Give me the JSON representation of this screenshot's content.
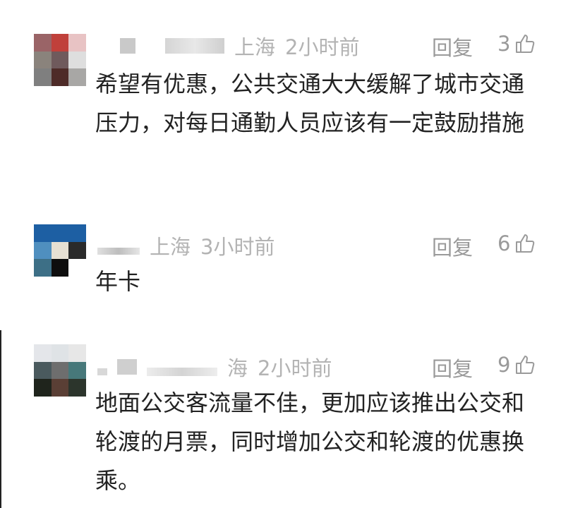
{
  "comments": [
    {
      "location": "上海",
      "time": "2小时前",
      "reply_label": "回复",
      "likes": "3",
      "text": "希望有优惠，公共交通大大缓解了城市交通压力，对每日通勤人员应该有一定鼓励措施",
      "avatar_colors": [
        "#9a6467",
        "#c0403b",
        "#e8c3c4",
        "#8a837c",
        "#6f5a5c",
        "#dedede",
        "#7f7f7f",
        "#4e2b28",
        "#a8a7a5"
      ]
    },
    {
      "location": "上海",
      "time": "3小时前",
      "reply_label": "回复",
      "likes": "6",
      "text": "年卡",
      "avatar_colors": [
        "#1d5fa3",
        "#1d5fa3",
        "#1d5fa3",
        "#4f8fbf",
        "#e6e0d3",
        "#2a2a2a",
        "#3d6f86",
        "#0e0e0e",
        "#ffffff"
      ]
    },
    {
      "location": "海",
      "time": "2小时前",
      "reply_label": "回复",
      "likes": "9",
      "text": "地面公交客流量不佳，更加应该推出公交和轮渡的月票，同时增加公交和轮渡的优惠换乘。",
      "avatar_colors": [
        "#e4e6ea",
        "#dfe3e6",
        "#e7e7e7",
        "#4a5a5e",
        "#6e6e6e",
        "#47787a",
        "#1f241c",
        "#5a3f35",
        "#2c352c"
      ]
    }
  ]
}
